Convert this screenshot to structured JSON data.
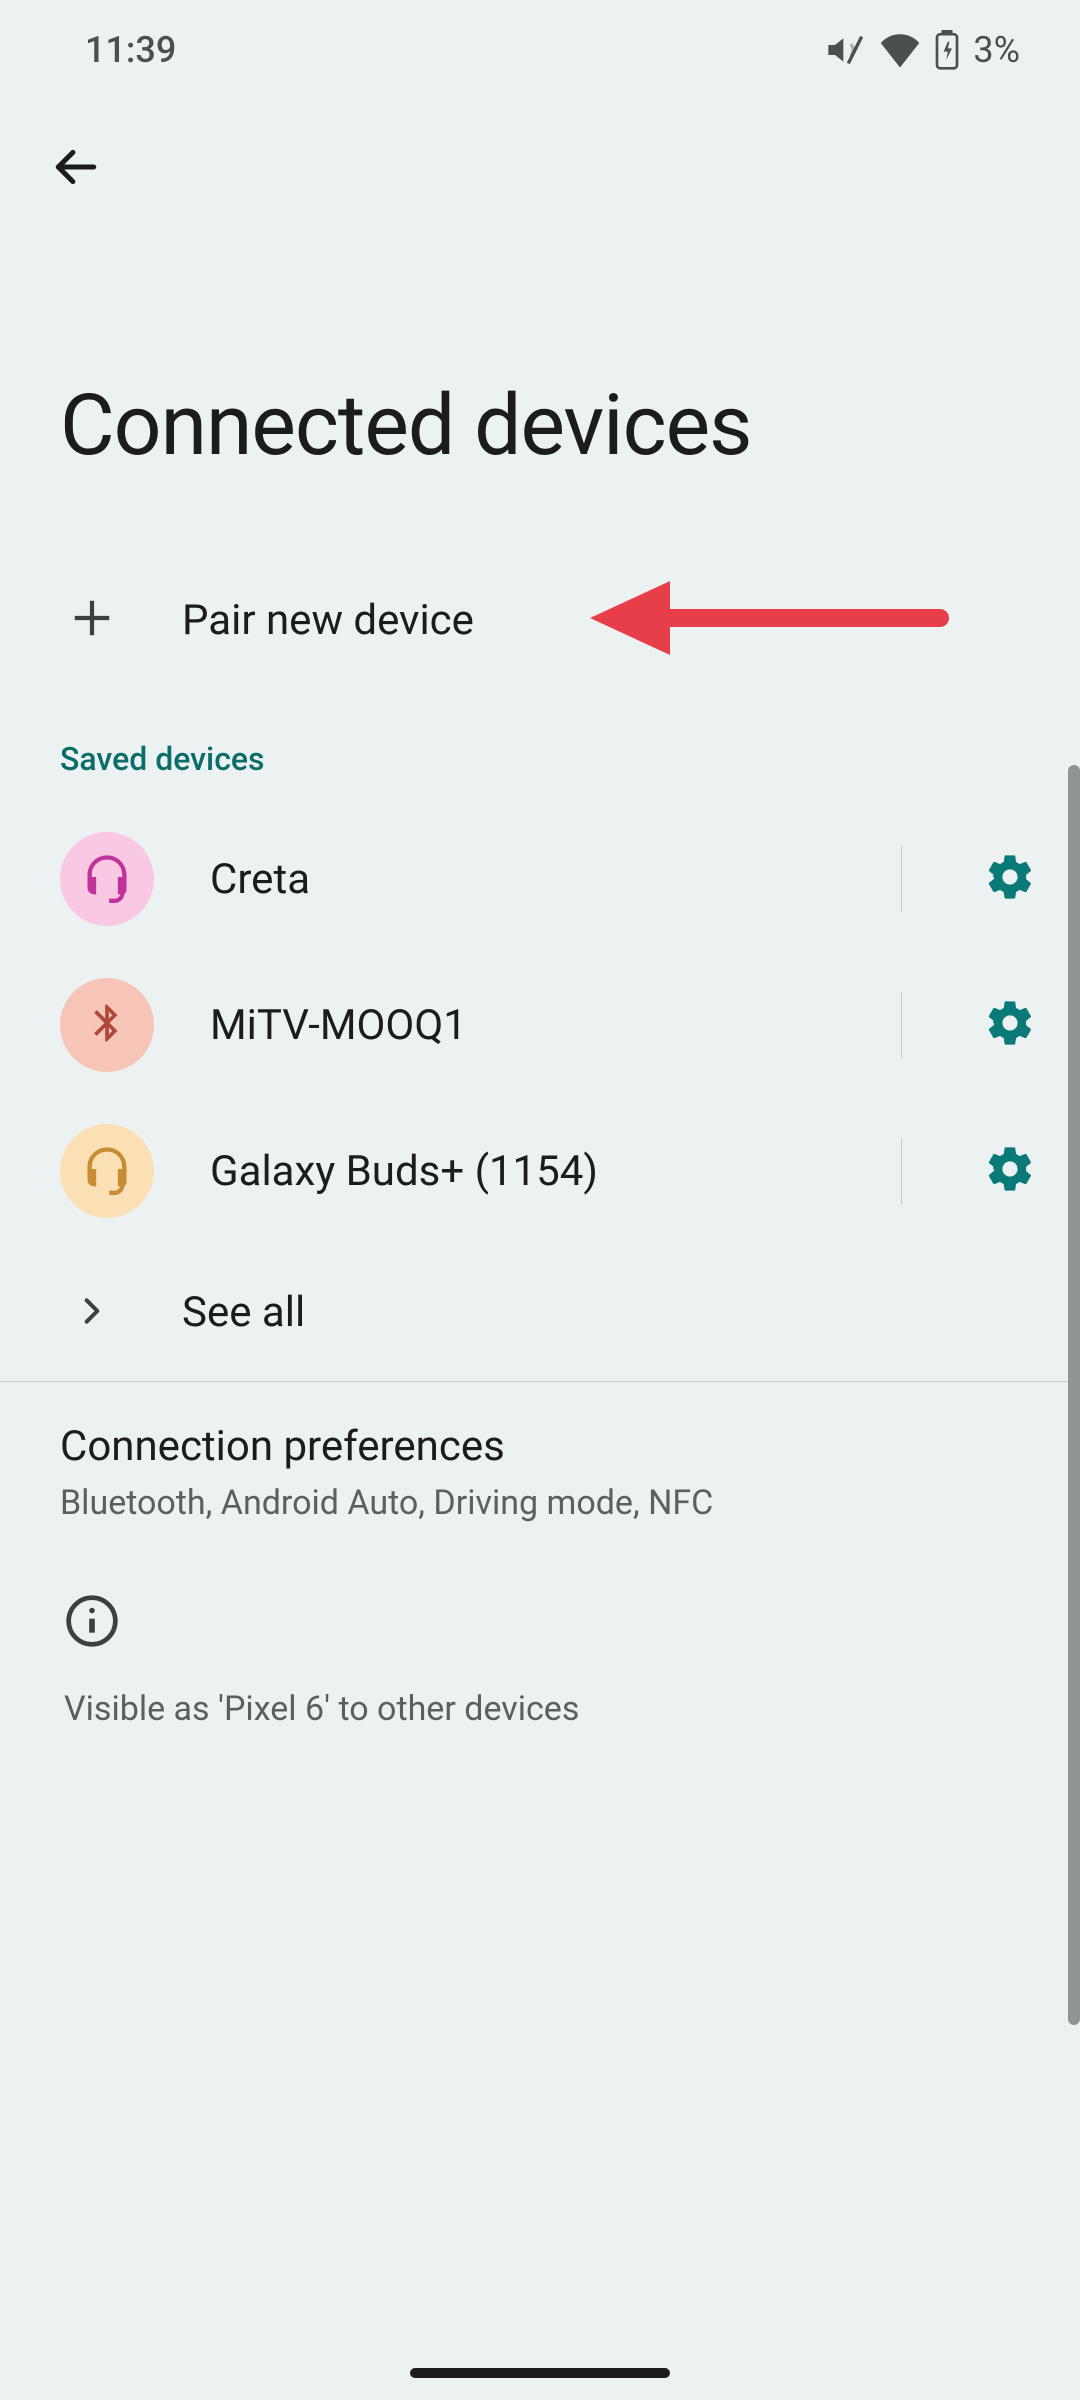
{
  "status_bar": {
    "time": "11:39",
    "battery_percent": "3%"
  },
  "page_title": "Connected devices",
  "pair_new_device_label": "Pair new device",
  "saved_devices_header": "Saved devices",
  "saved_devices": [
    {
      "name": "Creta",
      "icon": "headset",
      "icon_bg": "#f9c9e4",
      "icon_color": "#c0339a"
    },
    {
      "name": "MiTV-MOOQ1",
      "icon": "bluetooth",
      "icon_bg": "#f7c5b8",
      "icon_color": "#ae4839"
    },
    {
      "name": "Galaxy Buds+ (1154)",
      "icon": "headset",
      "icon_bg": "#fbdfb5",
      "icon_color": "#c78c34"
    }
  ],
  "see_all_label": "See all",
  "connection_preferences": {
    "title": "Connection preferences",
    "subtitle": "Bluetooth, Android Auto, Driving mode, NFC"
  },
  "visibility_text": "Visible as 'Pixel 6' to other devices",
  "accent_color": "#0a7a78"
}
